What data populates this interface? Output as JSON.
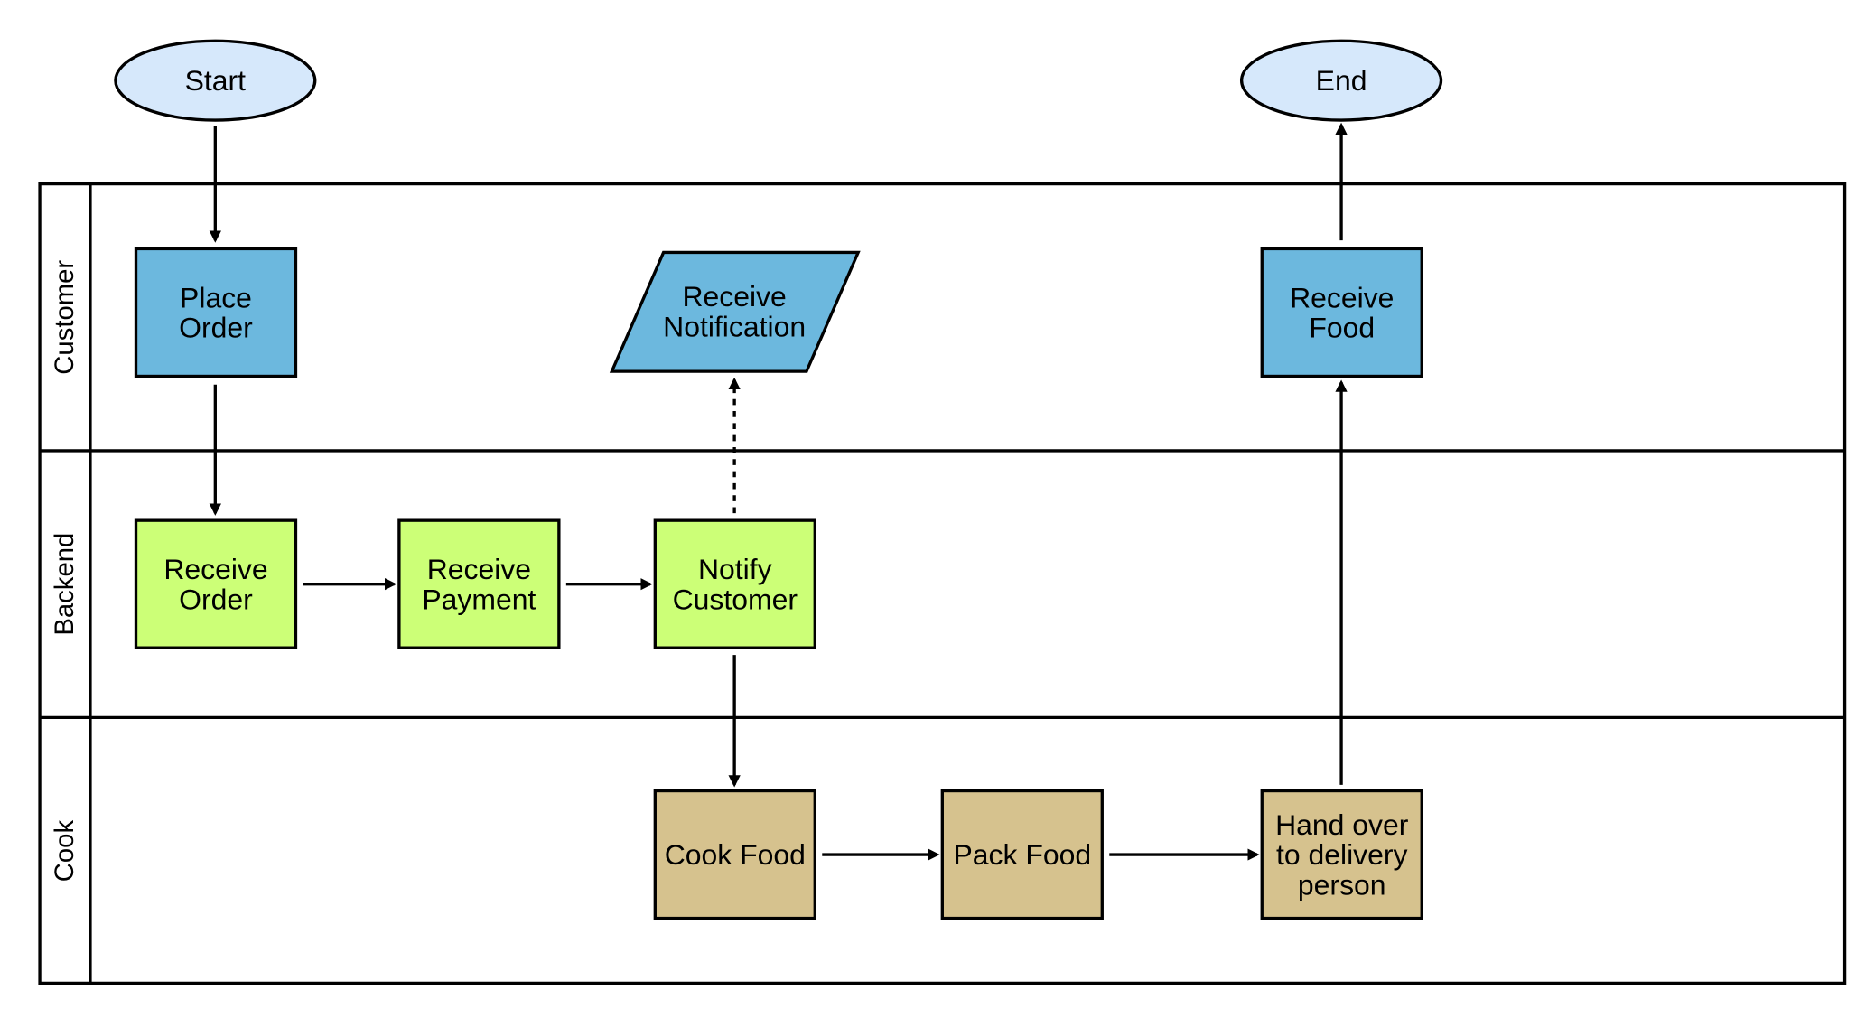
{
  "colors": {
    "terminal": "#d6e8fb",
    "customer": "#6cb8de",
    "backend": "#ccff77",
    "cook": "#d6c28e",
    "stroke": "#000000"
  },
  "terminals": {
    "start": "Start",
    "end": "End"
  },
  "lanes": [
    {
      "label": "Customer"
    },
    {
      "label": "Backend"
    },
    {
      "label": "Cook"
    }
  ],
  "nodes": {
    "place_order": [
      "Place",
      "Order"
    ],
    "receive_notification": [
      "Receive",
      "Notification"
    ],
    "receive_food": [
      "Receive",
      "Food"
    ],
    "receive_order": [
      "Receive",
      "Order"
    ],
    "receive_payment": [
      "Receive",
      "Payment"
    ],
    "notify_customer": [
      "Notify",
      "Customer"
    ],
    "cook_food": [
      "Cook Food"
    ],
    "pack_food": [
      "Pack Food"
    ],
    "hand_over": [
      "Hand over",
      "to delivery",
      "person"
    ]
  }
}
